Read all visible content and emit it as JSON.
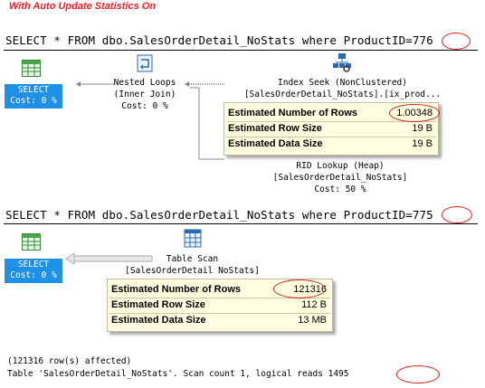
{
  "title": "With Auto Update Statistics On",
  "plan1": {
    "query": "SELECT * FROM dbo.SalesOrderDetail_NoStats where ProductID=776",
    "select": {
      "label": "SELECT",
      "cost": "Cost: 0 %"
    },
    "nested_loops": {
      "line1": "Nested Loops",
      "line2": "(Inner Join)",
      "cost": "Cost: 0 %"
    },
    "index_seek": {
      "line1": "Index Seek (NonClustered)",
      "line2": "[SalesOrderDetail_NoStats].[ix_prod..."
    },
    "rid_lookup": {
      "line1": "RID Lookup (Heap)",
      "line2": "[SalesOrderDetail_NoStats]",
      "cost": "Cost: 50 %"
    },
    "tooltip": {
      "rows": [
        {
          "label": "Estimated Number of Rows",
          "value": "1.00348"
        },
        {
          "label": "Estimated Row Size",
          "value": "19 B"
        },
        {
          "label": "Estimated Data Size",
          "value": "19 B"
        }
      ]
    }
  },
  "plan2": {
    "query": "SELECT * FROM dbo.SalesOrderDetail_NoStats where ProductID=775",
    "select": {
      "label": "SELECT",
      "cost": "Cost: 0 %"
    },
    "table_scan": {
      "line1": "Table Scan",
      "line2": "[SalesOrderDetail NoStats]"
    },
    "tooltip": {
      "rows": [
        {
          "label": "Estimated Number of Rows",
          "value": "121316"
        },
        {
          "label": "Estimated Row Size",
          "value": "112 B"
        },
        {
          "label": "Estimated Data Size",
          "value": "13 MB"
        }
      ]
    }
  },
  "output": {
    "line1": "(121316 row(s) affected)",
    "line2": "Table 'SalesOrderDetail_NoStats'. Scan count 1, logical reads 1495"
  },
  "colors": {
    "title": "#e8202a",
    "select_bg": "#1e90e6",
    "tooltip_bg": "#ffffe1",
    "circle": "#d21e1e"
  }
}
